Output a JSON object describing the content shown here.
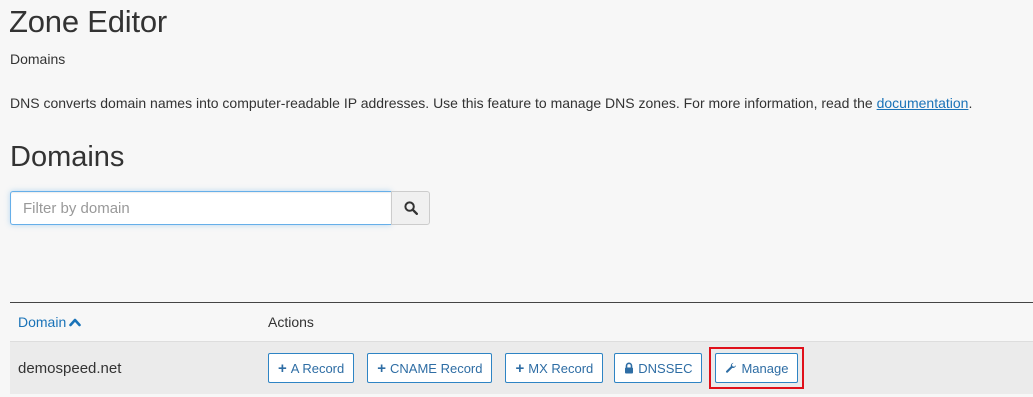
{
  "header": {
    "title": "Zone Editor",
    "breadcrumb": "Domains"
  },
  "description": {
    "text": "DNS converts domain names into computer-readable IP addresses. Use this feature to manage DNS zones. For more information, read the ",
    "link_label": "documentation",
    "suffix": "."
  },
  "domains_section": {
    "title": "Domains",
    "search": {
      "placeholder": "Filter by domain",
      "value": "",
      "button_icon": "search-icon"
    }
  },
  "table": {
    "columns": {
      "domain": "Domain",
      "actions": "Actions"
    },
    "sort_icon": "chevron-up-icon",
    "rows": [
      {
        "domain": "demospeed.net",
        "actions": {
          "a_record": "A Record",
          "cname_record": "CNAME Record",
          "mx_record": "MX Record",
          "dnssec": "DNSSEC",
          "manage": "Manage"
        }
      }
    ]
  },
  "colors": {
    "link": "#1a73b8",
    "button_border": "#2e84c4",
    "highlight": "#e0101a",
    "background": "#f7f7f7",
    "row_background": "#ebebeb"
  }
}
